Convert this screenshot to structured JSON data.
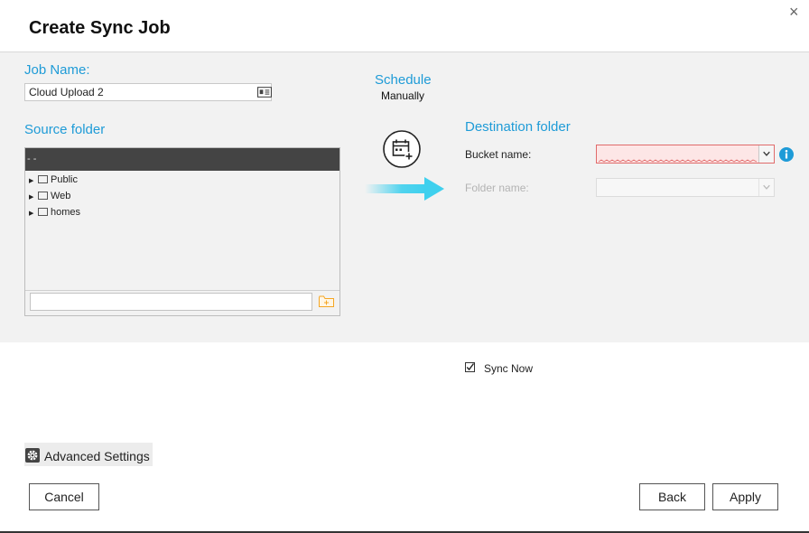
{
  "dialog": {
    "title": "Create Sync Job",
    "close_glyph": "×"
  },
  "job": {
    "label": "Job Name:",
    "value": "Cloud Upload 2",
    "icon": "id-card-icon"
  },
  "source": {
    "label": "Source folder",
    "tree_header": "- -",
    "items": [
      {
        "label": "Public"
      },
      {
        "label": "Web"
      },
      {
        "label": "homes"
      }
    ],
    "path_value": "",
    "new_folder_icon": "new-folder-icon"
  },
  "schedule": {
    "label": "Schedule",
    "value": "Manually",
    "icon": "calendar-add-icon"
  },
  "destination": {
    "label": "Destination folder",
    "bucket_label": "Bucket name:",
    "bucket_value": "",
    "folder_label": "Folder name:",
    "folder_value": "",
    "info_icon": "info-icon"
  },
  "sync_now": {
    "label": "Sync Now",
    "checked": true
  },
  "advanced": {
    "label": "Advanced Settings",
    "icon": "gear-icon"
  },
  "buttons": {
    "cancel": "Cancel",
    "back": "Back",
    "apply": "Apply"
  },
  "colors": {
    "accent": "#1e9bd7",
    "arrow": "#3fd0ee",
    "error_border": "#e06b6b",
    "error_fill": "#fde6e6",
    "info": "#1e9bd7",
    "folder_icon": "#f5a623"
  }
}
